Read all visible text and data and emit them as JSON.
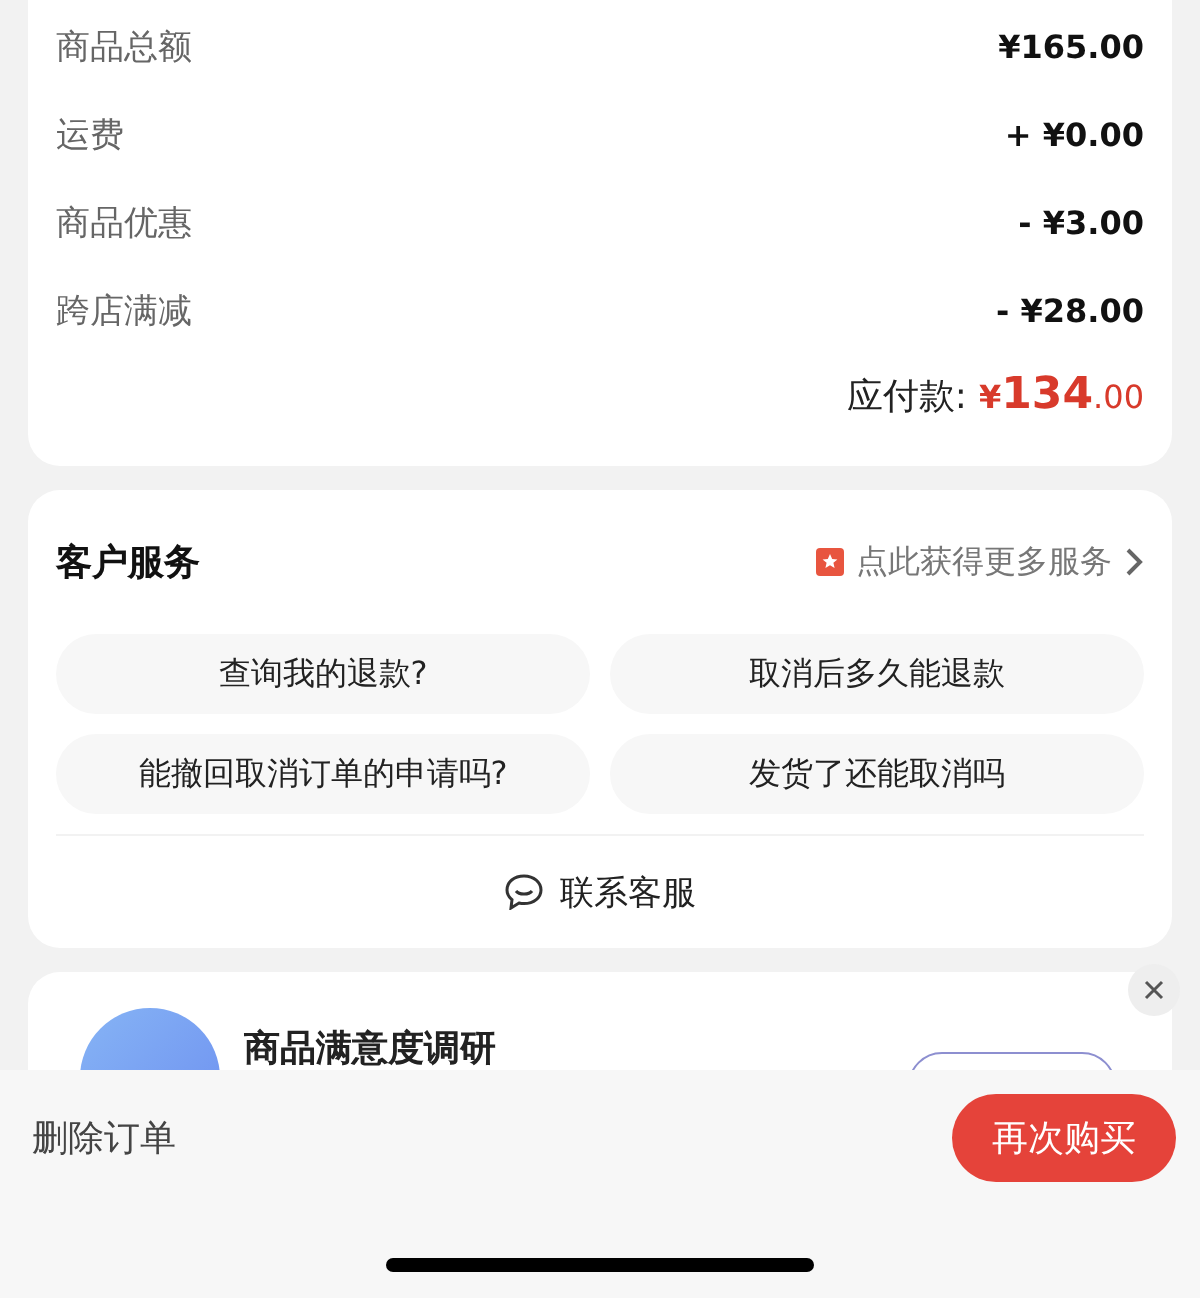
{
  "price_rows": [
    {
      "label": "商品总额",
      "value": "¥165.00"
    },
    {
      "label": "运费",
      "value": "+ ¥0.00"
    },
    {
      "label": "商品优惠",
      "value": "- ¥3.00"
    },
    {
      "label": "跨店满减",
      "value": "- ¥28.00"
    }
  ],
  "total": {
    "label": "应付款:",
    "currency": "¥",
    "integer": "134",
    "decimal": ".00"
  },
  "customer_service": {
    "title": "客户服务",
    "more_link": "点此获得更多服务",
    "questions": [
      "查询我的退款?",
      "取消后多久能退款",
      "能撤回取消订单的申请吗?",
      "发货了还能取消吗"
    ],
    "contact": "联系客服"
  },
  "survey": {
    "title": "商品满意度调研"
  },
  "bottom_bar": {
    "delete": "删除订单",
    "rebuy": "再次购买"
  }
}
